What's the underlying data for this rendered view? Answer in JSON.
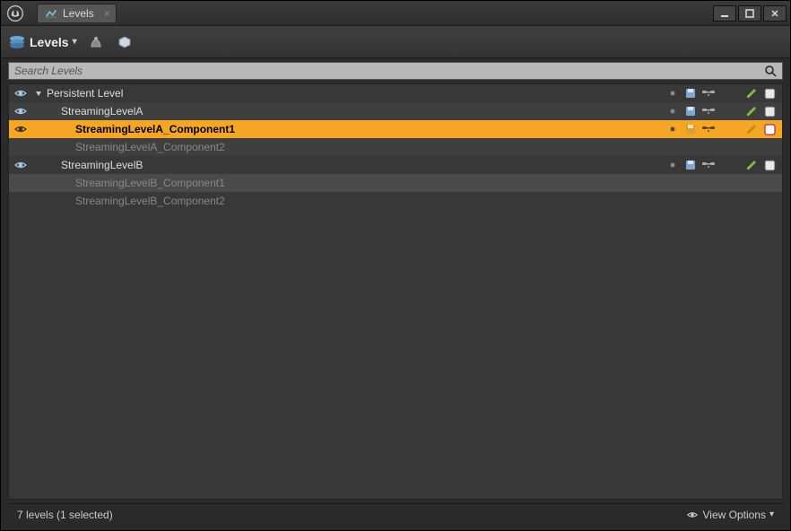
{
  "window": {
    "tab_title": "Levels"
  },
  "toolbar": {
    "main_label": "Levels"
  },
  "search": {
    "placeholder": "Search Levels"
  },
  "levels": [
    {
      "name": "Persistent Level",
      "indent": 0,
      "visible": true,
      "expand": true,
      "icons": true,
      "selected": false,
      "dim": false,
      "zebra": false
    },
    {
      "name": "StreamingLevelA",
      "indent": 1,
      "visible": true,
      "expand": false,
      "icons": true,
      "selected": false,
      "dim": false,
      "zebra": true
    },
    {
      "name": "StreamingLevelA_Component1",
      "indent": 2,
      "visible": true,
      "expand": false,
      "icons": true,
      "selected": true,
      "dim": false,
      "zebra": false
    },
    {
      "name": "StreamingLevelA_Component2",
      "indent": 2,
      "visible": false,
      "expand": false,
      "icons": false,
      "selected": false,
      "dim": true,
      "zebra": true
    },
    {
      "name": "StreamingLevelB",
      "indent": 1,
      "visible": true,
      "expand": false,
      "icons": true,
      "selected": false,
      "dim": false,
      "zebra": false
    },
    {
      "name": "StreamingLevelB_Component1",
      "indent": 2,
      "visible": false,
      "expand": false,
      "icons": false,
      "selected": false,
      "dim": true,
      "zebra": false,
      "hover": true
    },
    {
      "name": "StreamingLevelB_Component2",
      "indent": 2,
      "visible": false,
      "expand": false,
      "icons": false,
      "selected": false,
      "dim": true,
      "zebra": false
    }
  ],
  "status": {
    "text": "7 levels (1 selected)",
    "view_options": "View Options"
  }
}
